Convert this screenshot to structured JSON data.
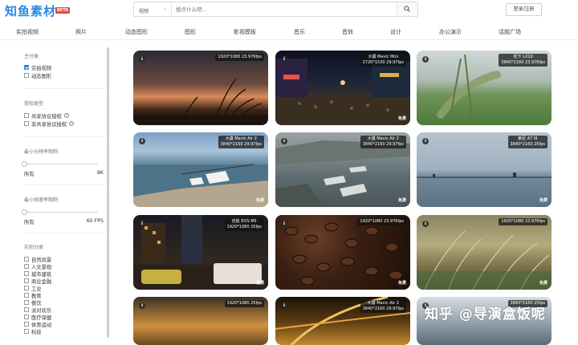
{
  "header": {
    "logo_text": "知鱼素材",
    "beta": "BETA",
    "search_category": "视频",
    "search_placeholder": "搜点什么吧...",
    "login_label": "登录/注册"
  },
  "nav": [
    "实拍视频",
    "照片",
    "动态图形",
    "图形",
    "影视模板",
    "音乐",
    "音效",
    "设计",
    "办公演示",
    "话题广场"
  ],
  "sidebar": {
    "main_category_title": "主分类",
    "main_categories": [
      {
        "label": "实拍视频",
        "checked": true
      },
      {
        "label": "动态图形",
        "checked": false
      }
    ],
    "license_title": "授权类型",
    "licenses": [
      {
        "label": "共享协议授权",
        "help": "?"
      },
      {
        "label": "非共享协议授权",
        "help": "?"
      }
    ],
    "min_resolution_title": "最小分辨率限制",
    "min_resolution_from": "所有",
    "min_resolution_to": "8K",
    "min_resolution_value": 0,
    "min_framerate_title": "最小帧速率限制",
    "min_framerate_from": "所有",
    "min_framerate_to": "60 FPS",
    "min_framerate_value": 0,
    "live_category_title": "实拍分类",
    "live_categories": [
      "自然风景",
      "人文景观",
      "城市建筑",
      "商业金融",
      "工业",
      "教育",
      "餐饮",
      "派对欢乐",
      "医疗保健",
      "体育运动",
      "科技"
    ]
  },
  "tiles": [
    {
      "meta": [
        "1920*1080 23.976fps"
      ],
      "free": ""
    },
    {
      "meta": [
        "大疆 Mavic Mini",
        "2720*1530 29.97fps"
      ],
      "free": "免费"
    },
    {
      "meta": [
        "松下 LX10",
        "3840*2160 23.976fps"
      ],
      "free": ""
    },
    {
      "meta": [
        "大疆 Mavic Air 2",
        "3840*2160 29.97fps"
      ],
      "free": "免费"
    },
    {
      "meta": [
        "大疆 Mavic Air 2",
        "3840*2160 29.97fps"
      ],
      "free": "免费"
    },
    {
      "meta": [
        "索尼 A7 III",
        "3840*2160 25fps"
      ],
      "free": "免费"
    },
    {
      "meta": [
        "佳能 EOS M5",
        "1920*1080 25fps"
      ],
      "free": "免费"
    },
    {
      "meta": [
        "1920*1080 23.976fps"
      ],
      "free": "免费"
    },
    {
      "meta": [
        "1920*1080 23.976fps"
      ],
      "free": "免费"
    },
    {
      "meta": [
        "1920*1080 25fps"
      ],
      "free": ""
    },
    {
      "meta": [
        "大疆 Mavic Air 2",
        "3840*2160 29.97fps"
      ],
      "free": ""
    },
    {
      "meta": [
        "",
        "3840*2160 25fps"
      ],
      "free": ""
    }
  ],
  "watermark": "知乎 @导演盒饭呢",
  "colors": {
    "accent": "#2b87e3",
    "beta": "#e54a3d"
  }
}
